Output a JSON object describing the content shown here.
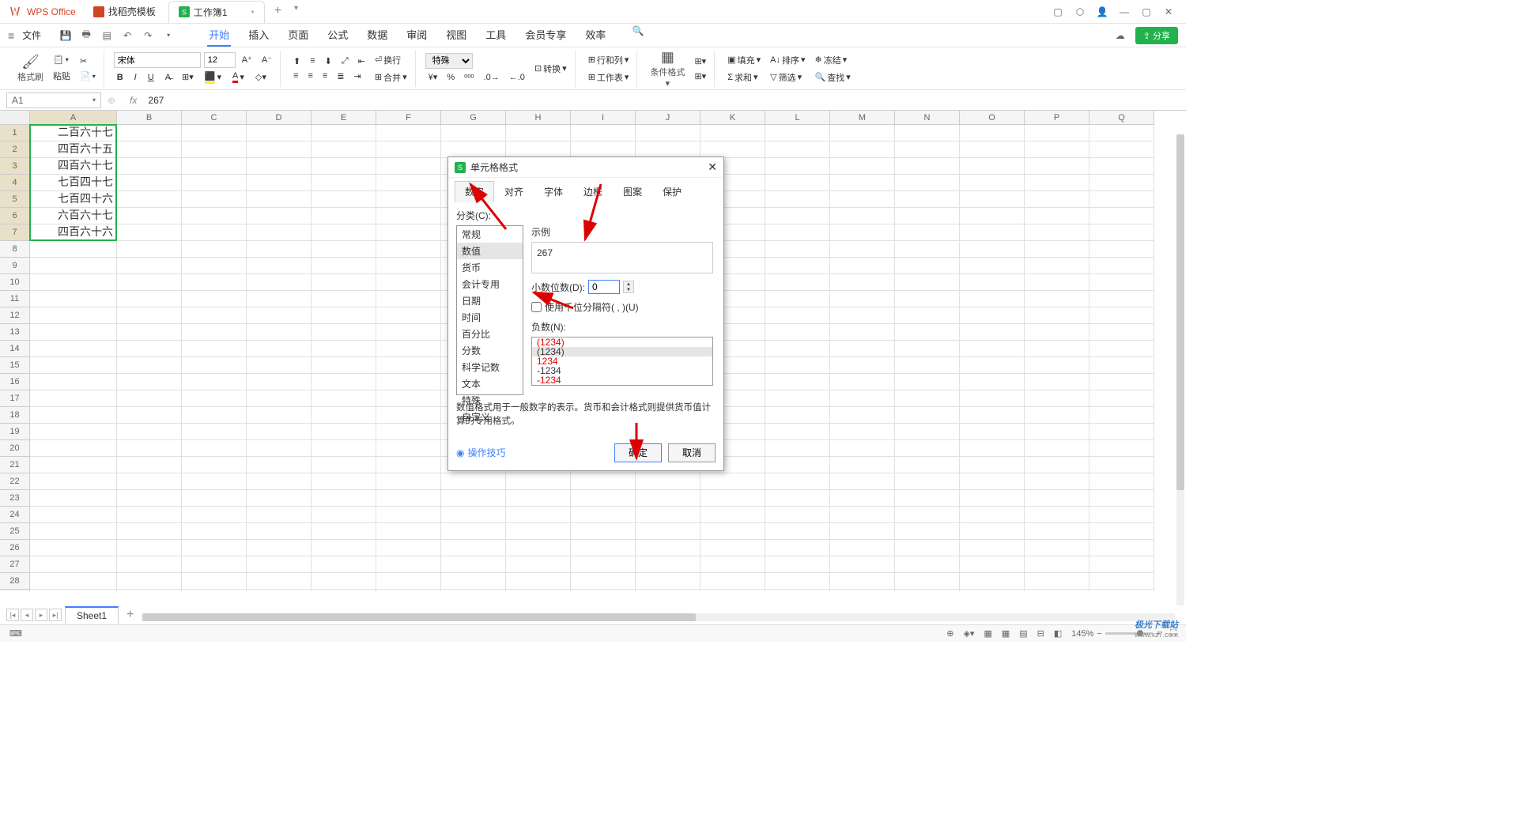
{
  "app": {
    "name": "WPS Office"
  },
  "title_tabs": {
    "t1": "找稻壳模板",
    "t2": "工作簿1"
  },
  "menu": {
    "file": "文件",
    "tabs": [
      "开始",
      "插入",
      "页面",
      "公式",
      "数据",
      "审阅",
      "视图",
      "工具",
      "会员专享",
      "效率"
    ],
    "share": "分享"
  },
  "ribbon": {
    "format_painter": "格式刷",
    "paste": "粘贴",
    "font_name": "宋体",
    "font_size": "12",
    "wrap": "换行",
    "special": "特殊",
    "convert": "转换",
    "rowcol": "行和列",
    "worksheet": "工作表",
    "cond_format": "条件格式",
    "fill": "填充",
    "sort": "排序",
    "freeze": "冻结",
    "sum": "求和",
    "filter": "筛选",
    "find": "查找",
    "merge": "合并"
  },
  "formula_bar": {
    "namebox": "A1",
    "fx": "fx",
    "value": "267"
  },
  "columns": [
    "A",
    "B",
    "C",
    "D",
    "E",
    "F",
    "G",
    "H",
    "I",
    "J",
    "K",
    "L",
    "M",
    "N",
    "O",
    "P",
    "Q"
  ],
  "cells": {
    "a1": "二百六十七",
    "a2": "四百六十五",
    "a3": "四百六十七",
    "a4": "七百四十七",
    "a5": "七百四十六",
    "a6": "六百六十七",
    "a7": "四百六十六"
  },
  "sheet_tab": "Sheet1",
  "status": {
    "zoom": "145%"
  },
  "dialog": {
    "title": "单元格格式",
    "tabs": [
      "数字",
      "对齐",
      "字体",
      "边框",
      "图案",
      "保护"
    ],
    "category_label": "分类(C):",
    "categories": [
      "常规",
      "数值",
      "货币",
      "会计专用",
      "日期",
      "时间",
      "百分比",
      "分数",
      "科学记数",
      "文本",
      "特殊",
      "自定义"
    ],
    "example_label": "示例",
    "example_value": "267",
    "decimal_label": "小数位数(D):",
    "decimal_value": "0",
    "thousand_sep": "使用千位分隔符( , )(U)",
    "negative_label": "负数(N):",
    "neg1": "(1234)",
    "neg2": "(1234)",
    "neg3": "1234",
    "neg4": "-1234",
    "neg5": "-1234",
    "desc": "数值格式用于一般数字的表示。货币和会计格式则提供货币值计算的专用格式。",
    "tips": "操作技巧",
    "ok": "确定",
    "cancel": "取消"
  },
  "watermark": {
    "top": "极光下载站",
    "bot": "www.xz7.com"
  }
}
